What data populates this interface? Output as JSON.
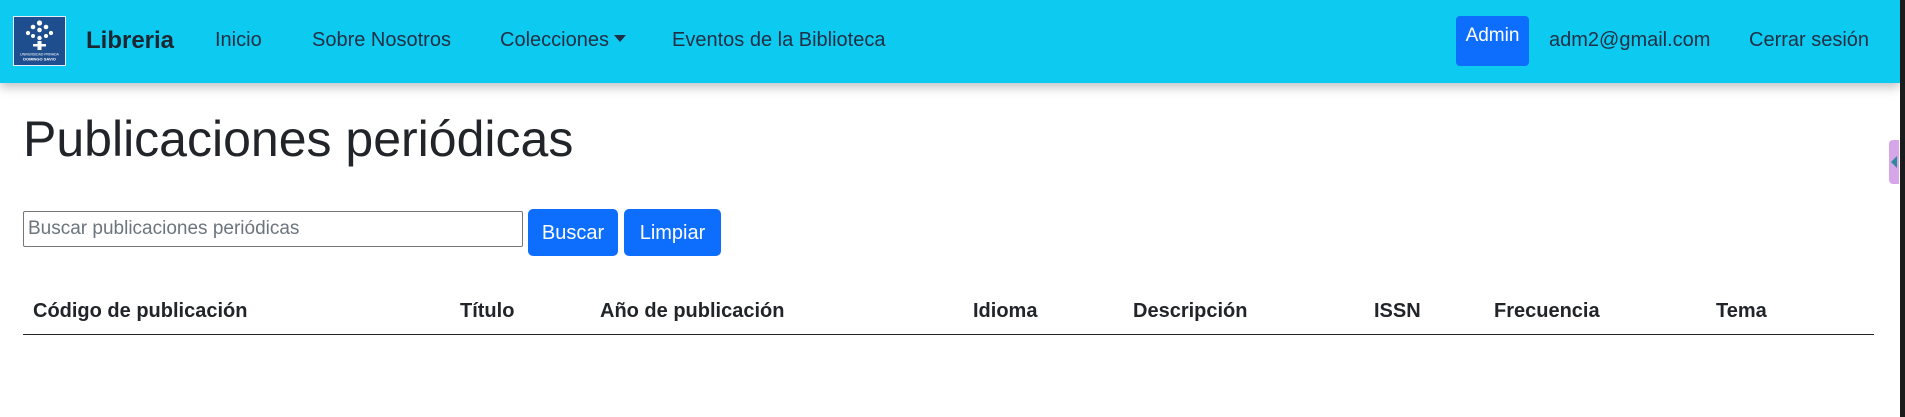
{
  "navbar": {
    "logo_icon": "university-logo-icon",
    "logo_text": [
      "UNIVERSIDAD PRIVADA",
      "DOMINGO SAVIO"
    ],
    "brand": "Libreria",
    "links": [
      {
        "label": "Inicio"
      },
      {
        "label": "Sobre Nosotros"
      },
      {
        "label": "Colecciones",
        "dropdown": true
      },
      {
        "label": "Eventos de la Biblioteca"
      }
    ],
    "admin_label": "Admin",
    "user_email": "adm2@gmail.com",
    "logout_label": "Cerrar sesión",
    "background_color": "#0dcaf0"
  },
  "main": {
    "title": "Publicaciones periódicas",
    "search": {
      "placeholder": "Buscar publicaciones periódicas",
      "value": ""
    },
    "search_button": "Buscar",
    "clear_button": "Limpiar",
    "button_color": "#0d6efd",
    "table": {
      "columns": [
        "Código de publicación",
        "Título",
        "Año de publicación",
        "Idioma",
        "Descripción",
        "ISSN",
        "Frecuencia",
        "Tema"
      ],
      "rows": []
    }
  }
}
